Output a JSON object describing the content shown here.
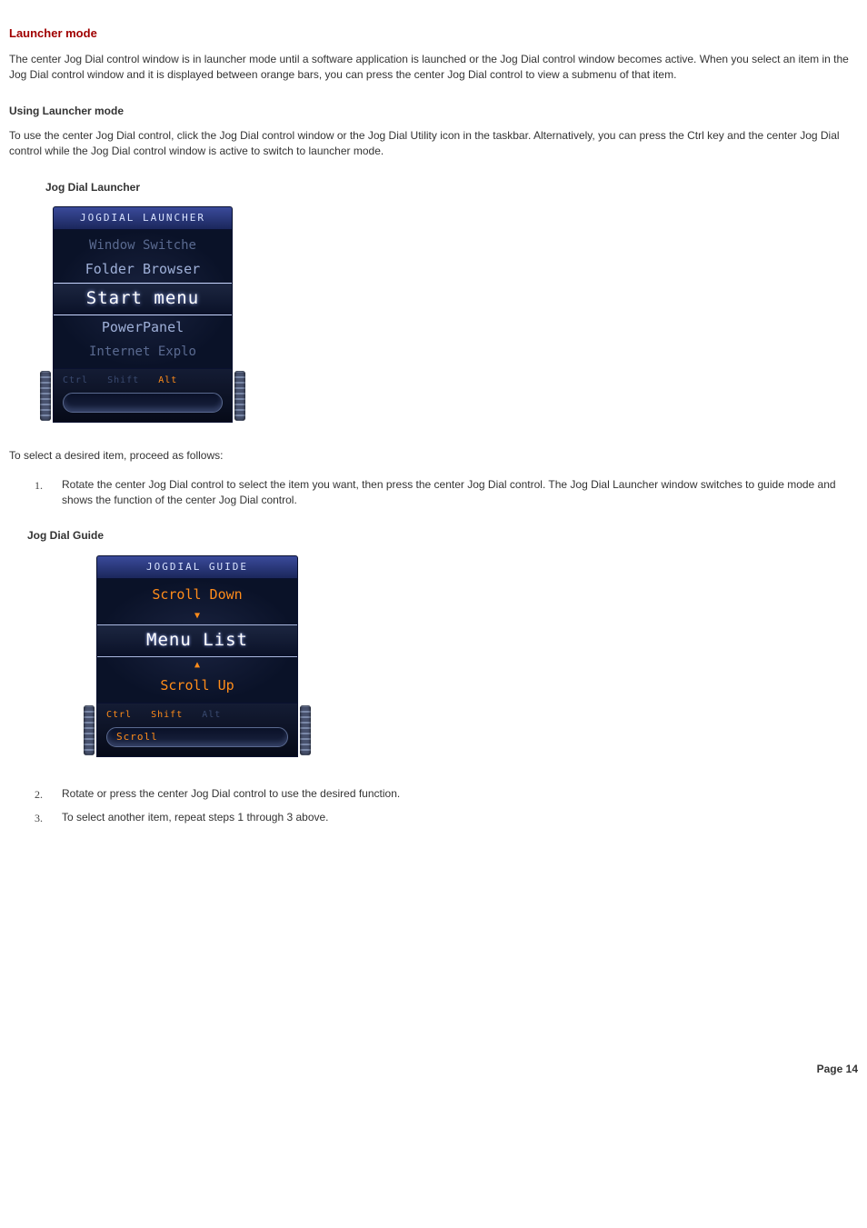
{
  "title": "Launcher mode",
  "intro_paragraph": "The center Jog Dial control window is in launcher mode until a software application is launched or the Jog Dial control window becomes active. When you select an item in the Jog Dial control window and it is displayed between orange bars, you can press the center Jog Dial control to view a submenu of that item.",
  "using_heading": "Using Launcher mode",
  "using_paragraph": "To use the center Jog Dial control, click the Jog Dial control window or the Jog Dial Utility icon in the taskbar. Alternatively, you can press the Ctrl key and the center Jog Dial control while the Jog Dial control window is active to switch to launcher mode.",
  "fig1_caption": "Jog Dial Launcher",
  "launcher": {
    "title": "JOGDIAL LAUNCHER",
    "items": [
      "Window Switche",
      "Folder Browser",
      "Start menu",
      "PowerPanel",
      "Internet Explo"
    ],
    "mods": {
      "ctrl": "Ctrl",
      "shift": "Shift",
      "alt": "Alt"
    },
    "slot": ""
  },
  "select_prompt": "To select a desired item, proceed as follows:",
  "steps": [
    "Rotate the center Jog Dial control to select the item you want, then press the center Jog Dial control. The Jog Dial Launcher window switches to guide mode and shows the function of the center Jog Dial control.",
    "Rotate or press the center Jog Dial control to use the desired function.",
    "To select another item, repeat steps 1 through 3 above."
  ],
  "fig2_caption": "Jog Dial Guide",
  "guide": {
    "title": "JOGDIAL GUIDE",
    "scroll_down": "Scroll Down",
    "menu_list": "Menu List",
    "scroll_up": "Scroll Up",
    "mods": {
      "ctrl": "Ctrl",
      "shift": "Shift",
      "alt": "Alt"
    },
    "slot": "Scroll"
  },
  "page_footer": "Page 14"
}
